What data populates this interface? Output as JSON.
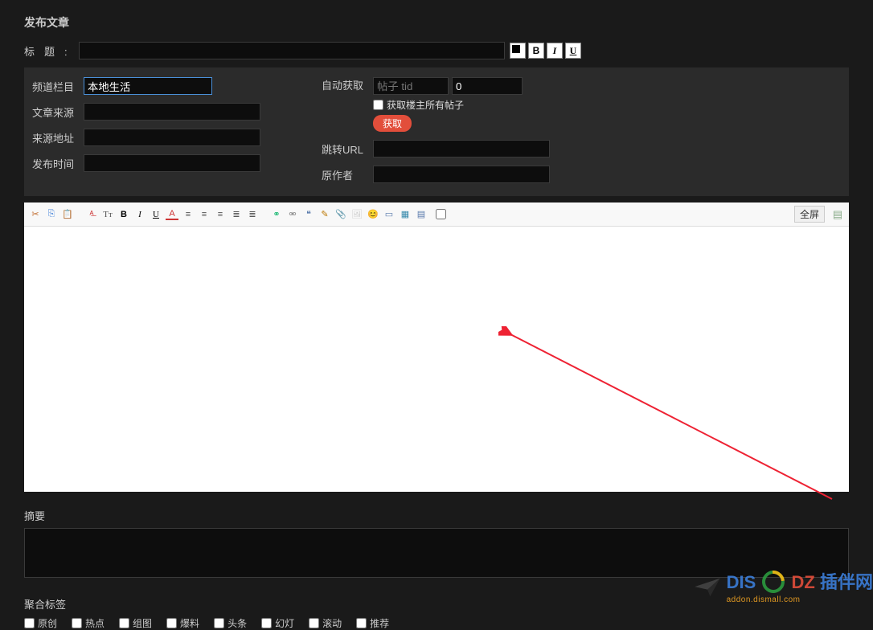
{
  "page_title": "发布文章",
  "title_row": {
    "label": "标题",
    "value": ""
  },
  "title_buttons": {
    "bg": "■",
    "bold": "B",
    "italic": "I",
    "underline": "U"
  },
  "left_fields": {
    "channel": {
      "label": "频道栏目",
      "value": "本地生活"
    },
    "source": {
      "label": "文章来源",
      "value": ""
    },
    "source_url": {
      "label": "来源地址",
      "value": ""
    },
    "pub_time": {
      "label": "发布时间",
      "value": ""
    }
  },
  "right_fields": {
    "auto_fetch": {
      "label": "自动获取",
      "tid_placeholder": "帖子 tid",
      "tid_value": "",
      "num_value": "0",
      "checkbox_label": "获取楼主所有帖子",
      "fetch_button": "获取"
    },
    "redirect_url": {
      "label": "跳转URL",
      "value": ""
    },
    "author": {
      "label": "原作者",
      "value": ""
    }
  },
  "toolbar": {
    "cut": "✂",
    "copy": "⎘",
    "paste": "📋",
    "removeformat": "ᴬ̶",
    "fontname": "Tт",
    "bold": "B",
    "italic": "I",
    "underline": "U",
    "fontcolor": "A",
    "alignleft": "≡",
    "aligncenter": "≡",
    "alignright": "≡",
    "ol": "≣",
    "ul": "≣",
    "link": "⚭",
    "unlink": "⚮",
    "quote": "❝",
    "code": "✎",
    "attach": "📎",
    "image": "🖼",
    "emoji": "😊",
    "media": "▭",
    "table": "▦",
    "page": "▤",
    "fullscreen": "全屏",
    "source_icon": "▤"
  },
  "editor_body": "",
  "abstract": {
    "label": "摘要",
    "value": ""
  },
  "tags": {
    "label": "聚合标签",
    "items": [
      "原创",
      "热点",
      "组图",
      "爆料",
      "头条",
      "幻灯",
      "滚动",
      "推荐"
    ]
  },
  "watermark": {
    "brand_prefix": "DIS",
    "brand_middle": "DZ",
    "brand_suffix": "插伴网",
    "url": "addon.dismall.com"
  }
}
